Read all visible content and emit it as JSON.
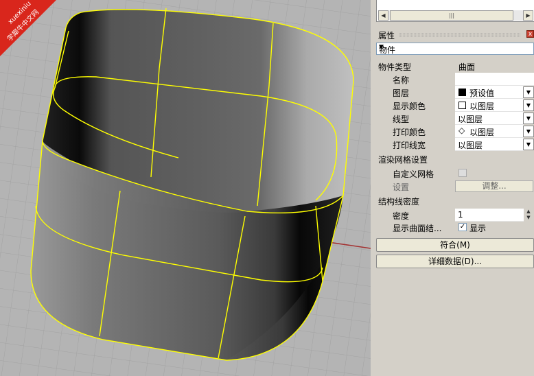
{
  "watermark": {
    "line1": "xuexiniu",
    "line2": "学犀牛中文网"
  },
  "properties_panel": {
    "title": "属性",
    "object_selector": "物件",
    "object_type_label": "物件类型",
    "object_type_value": "曲面",
    "name_label": "名称",
    "name_value": "",
    "layer_label": "图层",
    "layer_value": "预设值",
    "display_color_label": "显示颜色",
    "display_color_value": "以图层",
    "linetype_label": "线型",
    "linetype_value": "以图层",
    "print_color_label": "打印颜色",
    "print_color_value": "以图层",
    "print_width_label": "打印线宽",
    "print_width_value": "以图层",
    "render_mesh_section": "渲染网格设置",
    "custom_mesh_label": "自定义网格",
    "settings_label": "设置",
    "adjust_button": "调整...",
    "isocurve_section": "结构线密度",
    "density_label": "密度",
    "density_value": "1",
    "show_isocurves_label": "显示曲面结...",
    "show_isocurves_check": "显示",
    "match_button": "符合(M)",
    "details_button": "详细数据(D)..."
  },
  "colors": {
    "selection": "#ffff00",
    "viewport_bg": "#b4b4b4",
    "watermark": "#d9261c"
  }
}
